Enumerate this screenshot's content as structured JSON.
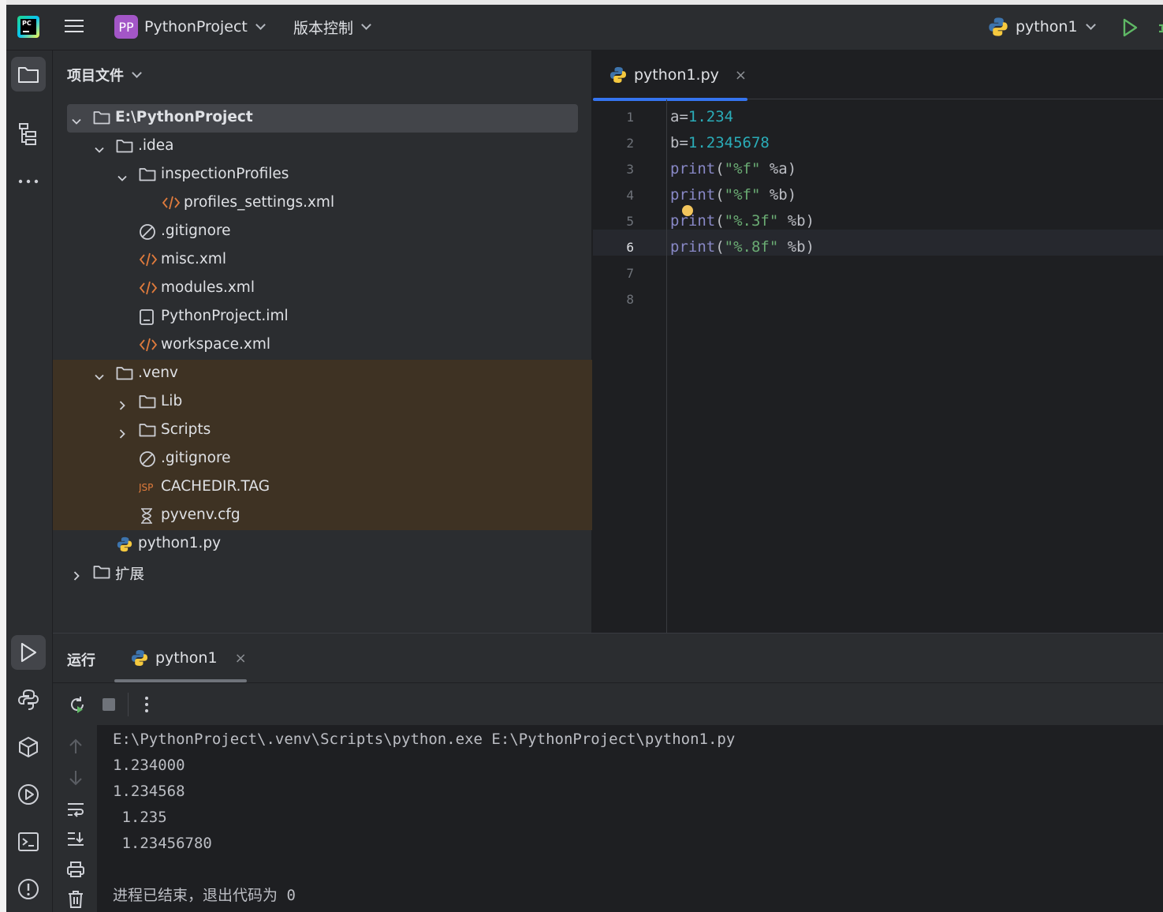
{
  "titlebar": {
    "project_badge": "PP",
    "project_name": "PythonProject",
    "vcs_label": "版本控制",
    "run_config": "python1"
  },
  "project_panel": {
    "header": "项目文件",
    "tree": [
      {
        "label": "E:\\PythonProject",
        "type": "folder",
        "expanded": true
      },
      {
        "label": ".idea",
        "type": "folder",
        "expanded": true
      },
      {
        "label": "inspectionProfiles",
        "type": "folder",
        "expanded": true
      },
      {
        "label": "profiles_settings.xml",
        "type": "xml"
      },
      {
        "label": ".gitignore",
        "type": "ignore"
      },
      {
        "label": "misc.xml",
        "type": "xml"
      },
      {
        "label": "modules.xml",
        "type": "xml"
      },
      {
        "label": "PythonProject.iml",
        "type": "iml"
      },
      {
        "label": "workspace.xml",
        "type": "xml"
      },
      {
        "label": ".venv",
        "type": "folder",
        "expanded": true
      },
      {
        "label": "Lib",
        "type": "folder",
        "expanded": false
      },
      {
        "label": "Scripts",
        "type": "folder",
        "expanded": false
      },
      {
        "label": ".gitignore",
        "type": "ignore"
      },
      {
        "label": "CACHEDIR.TAG",
        "type": "jsp"
      },
      {
        "label": "pyvenv.cfg",
        "type": "cfg"
      },
      {
        "label": "python1.py",
        "type": "python"
      },
      {
        "label": "扩展",
        "type": "folder",
        "expanded": false
      }
    ]
  },
  "editor": {
    "tab_label": "python1.py",
    "tab_close": "×",
    "line_numbers": [
      "1",
      "2",
      "3",
      "4",
      "5",
      "6",
      "7",
      "8"
    ],
    "current_line": 6,
    "code": [
      {
        "fn": "",
        "pre": "a=",
        "num": "1.234",
        "str": "",
        "post": ""
      },
      {
        "fn": "",
        "pre": "b=",
        "num": "1.2345678",
        "str": "",
        "post": ""
      },
      {
        "fn": "print",
        "pre": "(",
        "num": "",
        "str": "\"%f\"",
        "post": " %a)"
      },
      {
        "fn": "print",
        "pre": "(",
        "num": "",
        "str": "\"%f\"",
        "post": " %b)"
      },
      {
        "fn": "print",
        "pre": "(",
        "num": "",
        "str": "\"%.3f\"",
        "post": " %b)"
      },
      {
        "fn": "print",
        "pre": "(",
        "num": "",
        "str": "\"%.8f\"",
        "post": " %b)"
      }
    ]
  },
  "run_panel": {
    "title": "运行",
    "tab_label": "python1",
    "tab_close": "×",
    "output": [
      "E:\\PythonProject\\.venv\\Scripts\\python.exe E:\\PythonProject\\python1.py",
      "1.234000",
      "1.234568",
      " 1.235",
      " 1.23456780",
      "",
      "进程已结束，退出代码为 0"
    ]
  },
  "colors": {
    "accent_blue": "#3574f0",
    "run_green": "#5fb865",
    "excluded_bg": "#3e3223",
    "project_badge": "#a356c7"
  },
  "icons": [
    "pycharm-logo",
    "hamburger-icon",
    "folder-icon",
    "structure-icon",
    "more-icon",
    "run-icon",
    "python-console-icon",
    "python-packages-icon",
    "services-icon",
    "terminal-icon",
    "problems-icon",
    "rerun-icon",
    "stop-icon",
    "up-arrow-icon",
    "down-arrow-icon",
    "soft-wrap-icon",
    "scroll-to-end-icon",
    "print-icon",
    "trash-icon"
  ]
}
